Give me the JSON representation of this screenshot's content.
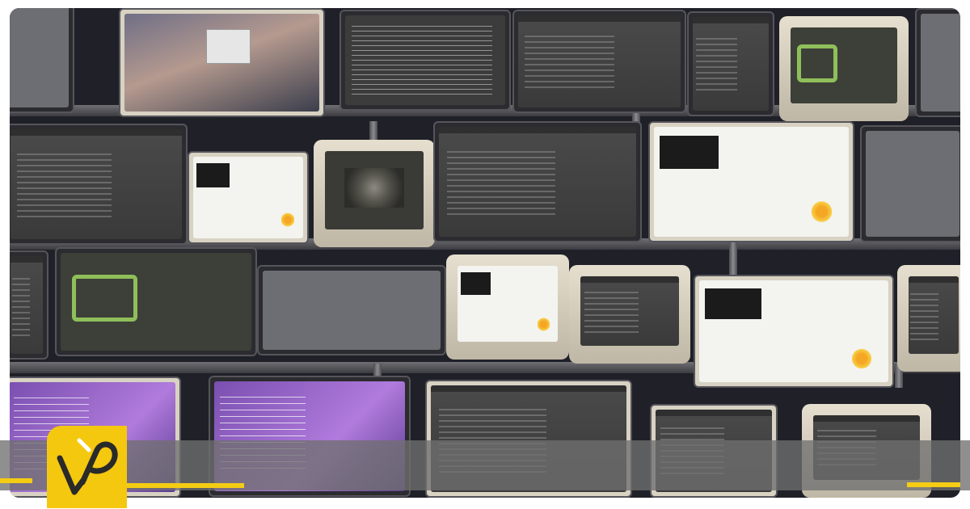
{
  "scene": {
    "description_tags": [
      "monitor-wall",
      "screens"
    ],
    "banner_color": "#707070",
    "accent_color": "#f4cc14",
    "frame_color": "#1f2028"
  },
  "logo": {
    "icon": "brand-logo-icon",
    "color": "#f4c80f"
  }
}
